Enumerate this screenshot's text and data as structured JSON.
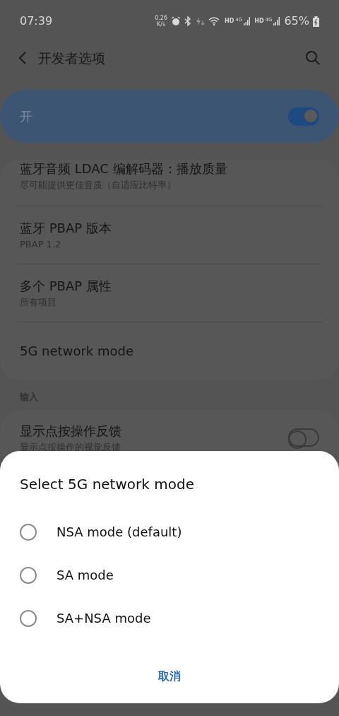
{
  "status_bar": {
    "time": "07:39",
    "speed": [
      "0.26",
      "K/s"
    ],
    "networks": [
      {
        "hd": "HD",
        "gen": "4G"
      },
      {
        "hd": "HD",
        "gen": "4G"
      }
    ],
    "battery": "65%"
  },
  "header": {
    "title": "开发者选项"
  },
  "master_switch": {
    "label": "开",
    "on": true
  },
  "settings": [
    {
      "title": "蓝牙音频 LDAC 编解码器：播放质量",
      "subtitle": "尽可能提供更佳音质（自适应比特率）"
    },
    {
      "title": "蓝牙 PBAP 版本",
      "subtitle": "PBAP 1.2"
    },
    {
      "title": "多个 PBAP 属性",
      "subtitle": "所有项目"
    },
    {
      "title": "5G network mode"
    }
  ],
  "section": {
    "header": "输入",
    "items": [
      {
        "title": "显示点按操作反馈",
        "subtitle": "显示点按操作的视觉反馈",
        "on": false
      }
    ]
  },
  "dialog": {
    "title": "Select 5G network mode",
    "options": [
      {
        "label": "NSA mode (default)",
        "selected": false
      },
      {
        "label": "SA mode",
        "selected": false
      },
      {
        "label": "SA+NSA mode",
        "selected": false
      }
    ],
    "cancel": "取消"
  }
}
